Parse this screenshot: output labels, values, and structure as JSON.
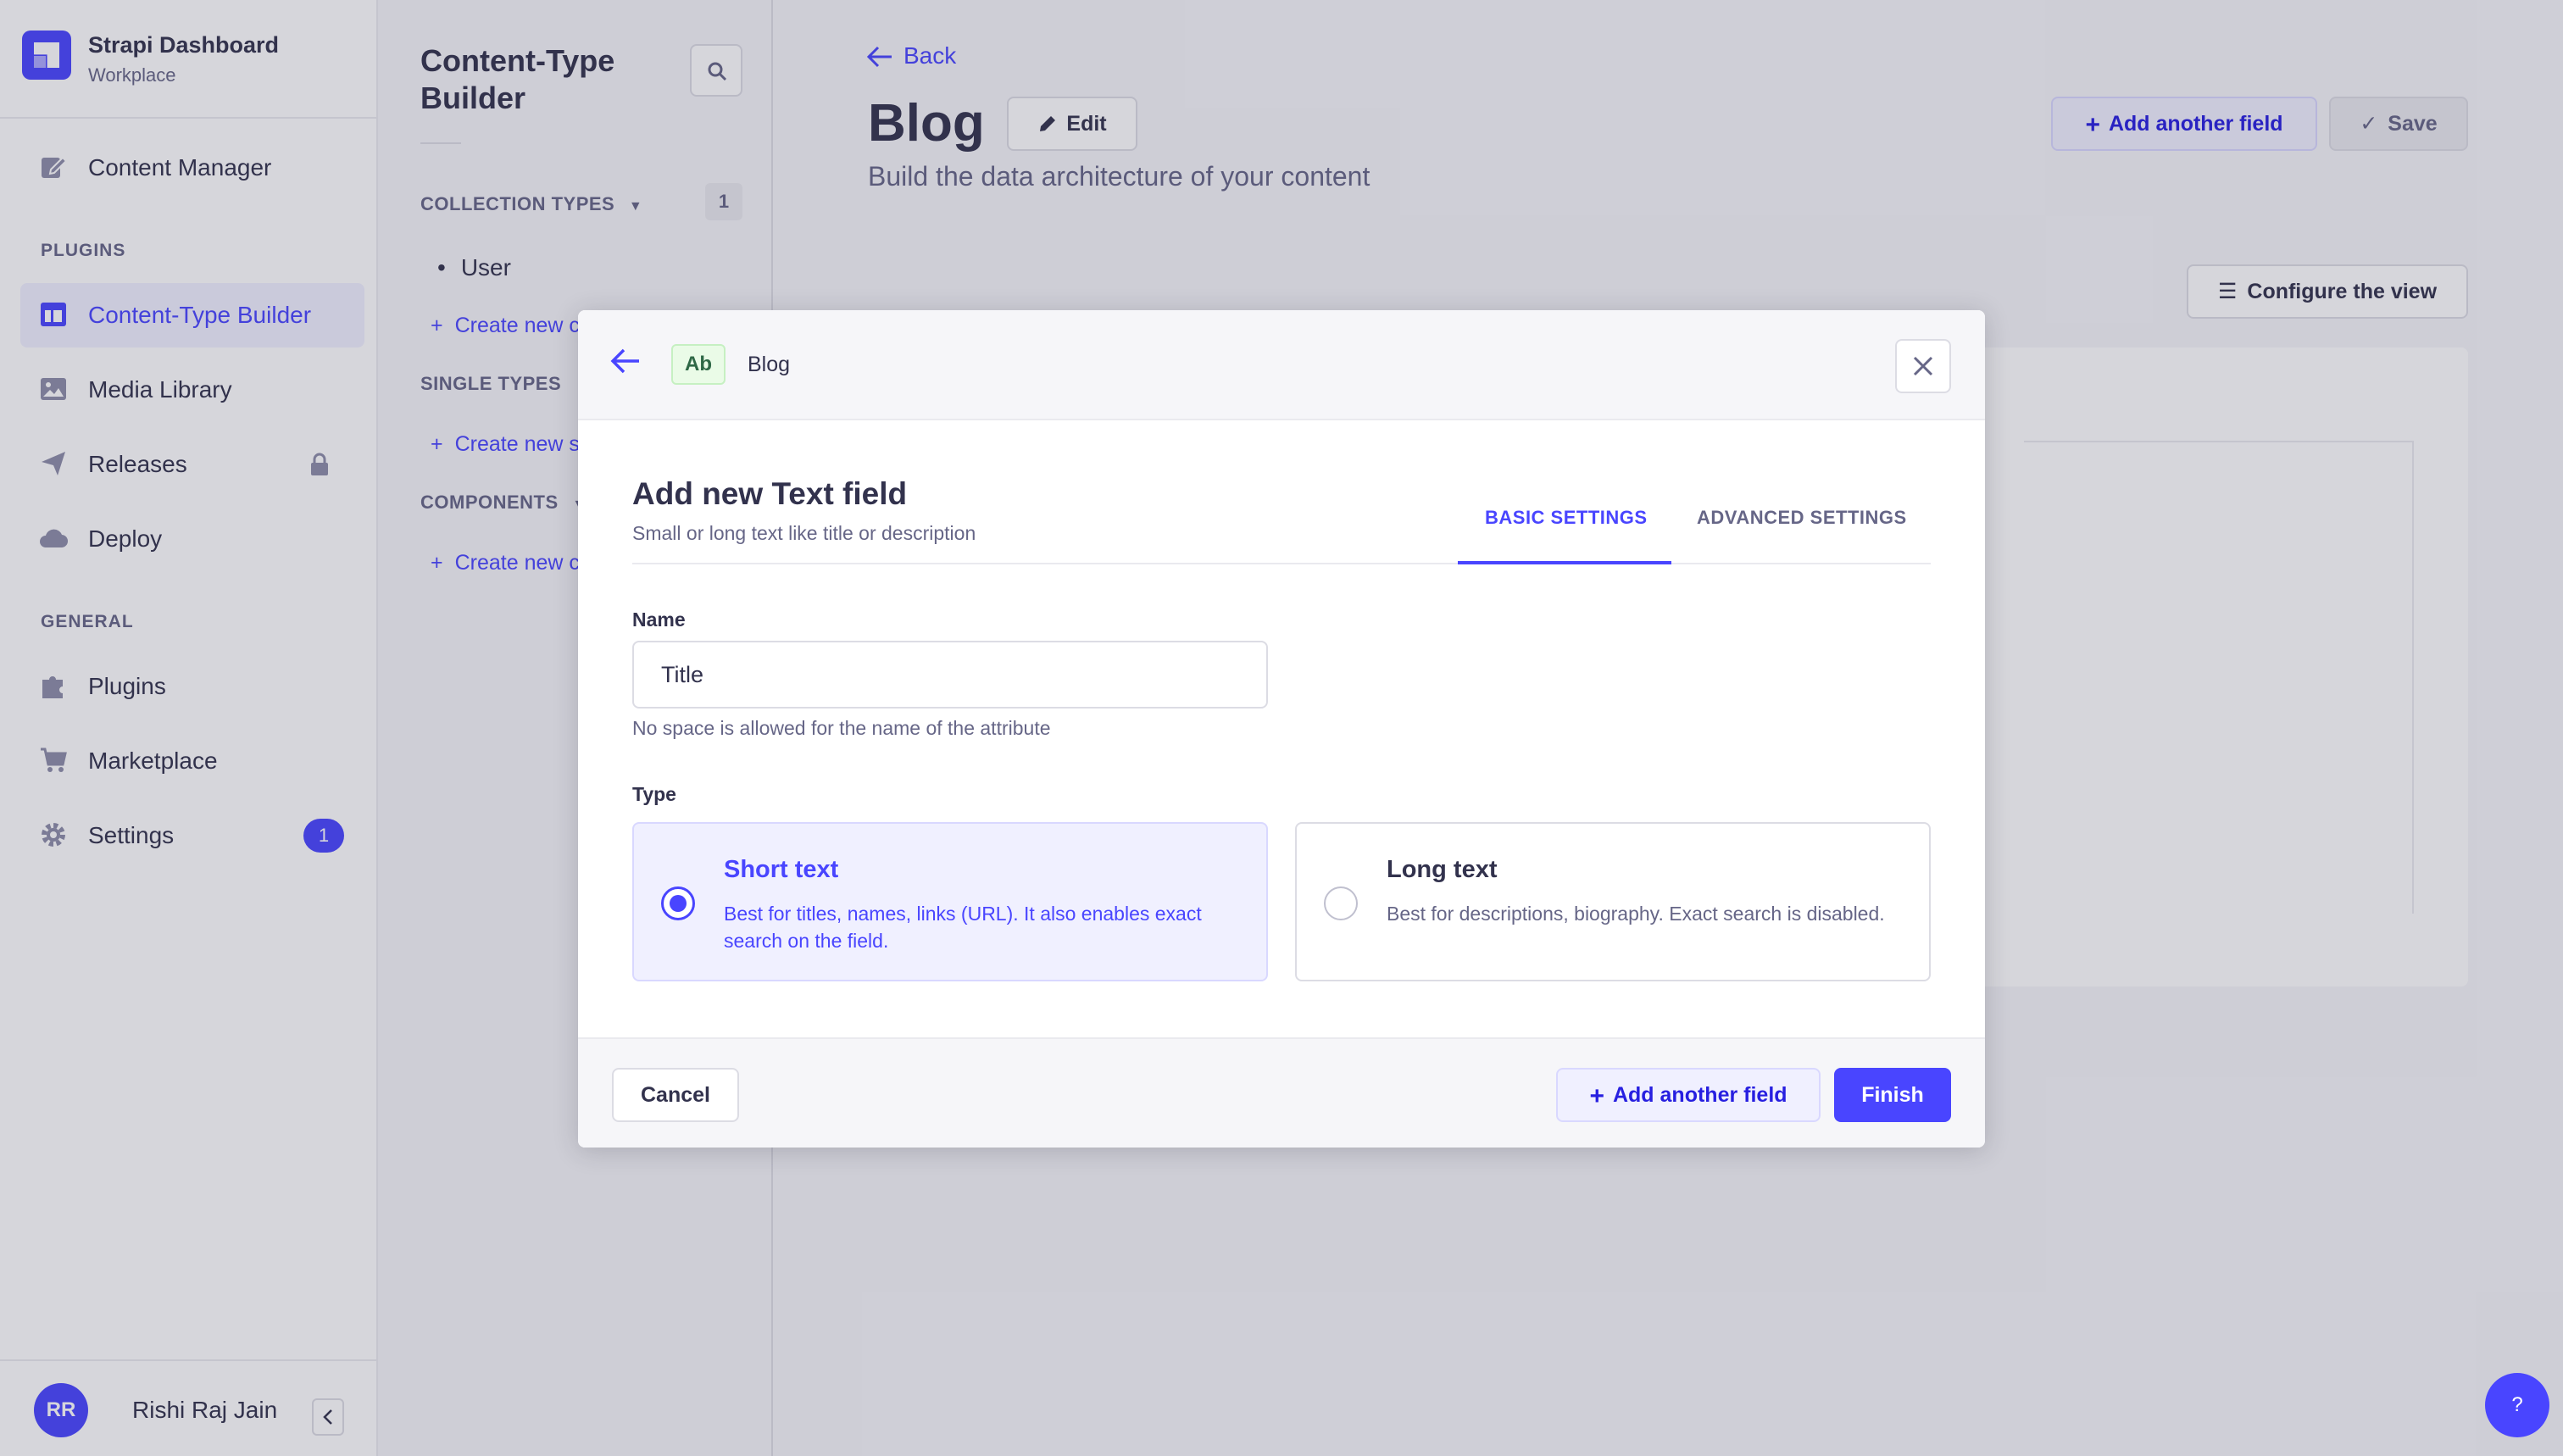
{
  "brand": {
    "title": "Strapi Dashboard",
    "subtitle": "Workplace"
  },
  "nav": {
    "content_manager": "Content Manager",
    "plugins_section": "PLUGINS",
    "content_type_builder": "Content-Type Builder",
    "media_library": "Media Library",
    "releases": "Releases",
    "deploy": "Deploy",
    "general_section": "GENERAL",
    "plugins": "Plugins",
    "marketplace": "Marketplace",
    "settings": "Settings",
    "settings_badge": "1"
  },
  "user": {
    "initials": "RR",
    "name": "Rishi Raj Jain"
  },
  "subnav": {
    "title": "Content-Type Builder",
    "collection_types": "COLLECTION TYPES",
    "collection_count": "1",
    "collection_items": [
      "User"
    ],
    "create_collection": "Create new c",
    "single_types": "SINGLE TYPES",
    "create_single": "Create new s",
    "components": "COMPONENTS",
    "create_component": "Create new c"
  },
  "header": {
    "back": "Back",
    "title": "Blog",
    "edit": "Edit",
    "subtitle": "Build the data architecture of your content",
    "add_another_field": "Add another field",
    "save": "Save",
    "configure_view": "Configure the view"
  },
  "modal": {
    "badge": "Ab",
    "breadcrumb": "Blog",
    "title": "Add new Text field",
    "description": "Small or long text like title or description",
    "tabs": {
      "basic": "BASIC SETTINGS",
      "advanced": "ADVANCED SETTINGS"
    },
    "name_label": "Name",
    "name_value": "Title",
    "name_hint": "No space is allowed for the name of the attribute",
    "type_label": "Type",
    "short_text": {
      "title": "Short text",
      "description": "Best for titles, names, links (URL). It also enables exact search on the field."
    },
    "long_text": {
      "title": "Long text",
      "description": "Best for descriptions, biography. Exact search is disabled."
    },
    "cancel": "Cancel",
    "add_another_field": "Add another field",
    "finish": "Finish"
  },
  "help": "?",
  "colors": {
    "primary": "#4945ff",
    "text": "#32324d",
    "muted": "#666687",
    "light_bg": "#f6f6f9"
  }
}
